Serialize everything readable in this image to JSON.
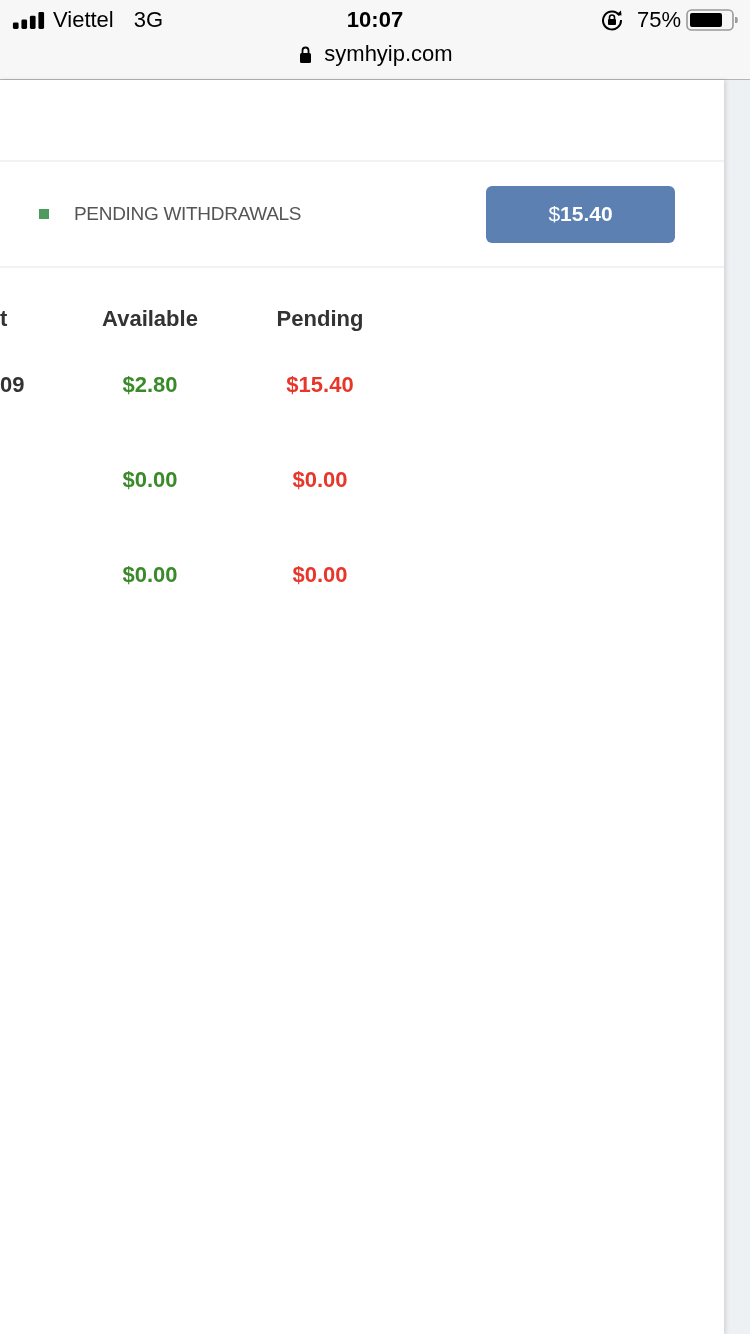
{
  "status_bar": {
    "carrier": "Viettel",
    "network": "3G",
    "time": "10:07",
    "battery": "75%"
  },
  "browser": {
    "url": "symhyip.com"
  },
  "summary": {
    "label": "PENDING WITHDRAWALS",
    "amount": "$**15.40**"
  },
  "table": {
    "columns": {
      "column_1": "t",
      "available": "Available",
      "pending": "Pending"
    },
    "rows": [
      {
        "column_1": "09",
        "available": "$2.80",
        "pending": "$15.40"
      },
      {
        "available": "$0.00",
        "pending": "$0.00"
      },
      {
        "available": "$0.00",
        "pending": "$0.00"
      }
    ]
  }
}
